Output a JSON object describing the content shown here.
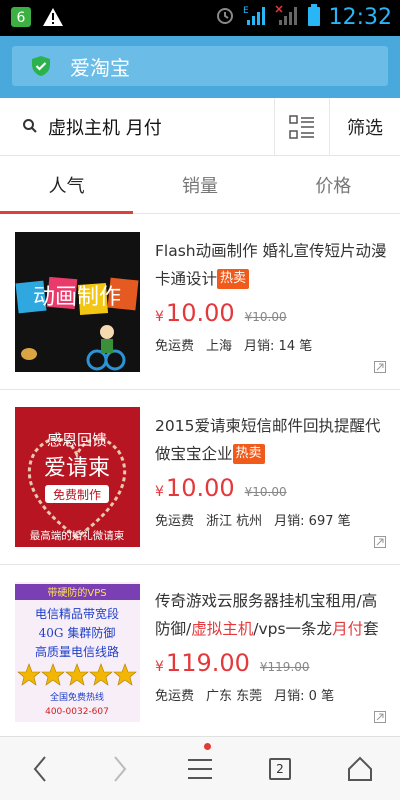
{
  "status_bar": {
    "time": "12:32",
    "network": "E"
  },
  "app_bar": {
    "site_title": "爱淘宝"
  },
  "search": {
    "query": "虚拟主机 月付",
    "filter_label": "筛选"
  },
  "tabs": [
    {
      "label": "人气",
      "active": true
    },
    {
      "label": "销量",
      "active": false
    },
    {
      "label": "价格",
      "active": false
    }
  ],
  "products": [
    {
      "title_parts": [
        "Flash动画制作 婚礼宣传短片动漫卡通设计"
      ],
      "hot_label": "热卖",
      "currency": "¥",
      "price": "10.00",
      "old_price": "¥10.00",
      "shipping": "免运费",
      "location": "上海",
      "sales": "月销: 14 笔",
      "thumb_text": "动画制作"
    },
    {
      "title_parts": [
        "2015爱请柬短信邮件回执提醒代做宝宝企业"
      ],
      "hot_label": "热卖",
      "currency": "¥",
      "price": "10.00",
      "old_price": "¥10.00",
      "shipping": "免运费",
      "location": "浙江 杭州",
      "sales": "月销: 697 笔",
      "thumb_lines": [
        "感恩回馈",
        "爱请柬",
        "免费制作",
        "最高端的婚礼微请柬"
      ]
    },
    {
      "title_before": "传奇游戏云服务器挂机宝租用/高防御/",
      "title_hl1": "虚拟主机",
      "title_mid": "/vps一条龙",
      "title_hl2": "月付",
      "title_after": "套",
      "currency": "¥",
      "price": "119.00",
      "old_price": "¥119.00",
      "shipping": "免运费",
      "location": "广东 东莞",
      "sales": "月销: 0 笔",
      "thumb_lines": [
        "带硬防的VPS",
        "电信精品带宽段",
        "40G 集群防御",
        "高质量电信线路",
        "全国免费热线",
        "400-0032-607"
      ]
    }
  ],
  "bottom_nav": {
    "tab_count": "2"
  },
  "colors": {
    "accent_blue": "#4aa9dc",
    "price_red": "#e4393c",
    "hot_orange": "#f05a1a",
    "tab_underline": "#e0403a"
  }
}
